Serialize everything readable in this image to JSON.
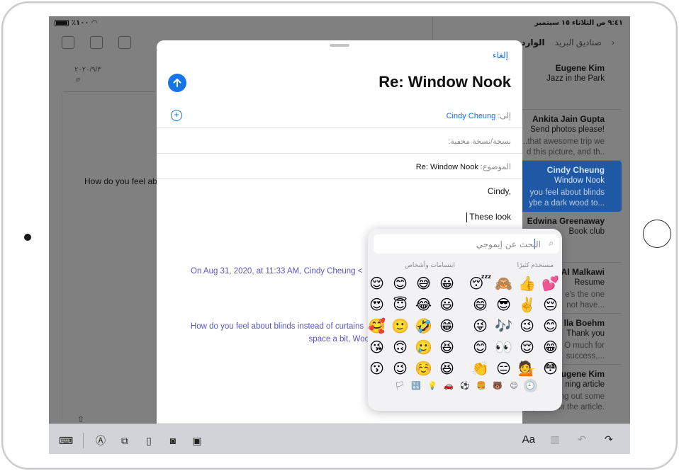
{
  "status": {
    "battery": "٪١٠٠",
    "time_date": "٩:٤١ ص  الثلاثاء ١٥ سبتمبر"
  },
  "message_view": {
    "date": "٢٠٢٠/٩/٣",
    "body_preview": "How do you feel ab"
  },
  "mailbox": {
    "back_label": "صناديق البريد",
    "inbox_label": "الوارد",
    "items": [
      {
        "name": "Eugene Kim",
        "subject": "Jazz in the Park",
        "preview": ""
      },
      {
        "name": "Ankita Jain Gupta",
        "subject": "Send photos please!",
        "preview": "...that awesome trip we\nd this picture, and th.."
      },
      {
        "name": "Cindy Cheung",
        "subject": "Window Nook",
        "preview": "you feel about blinds\nybe a dark wood to..."
      },
      {
        "name": "Edwina Greenaway",
        "subject": "Book club",
        "preview": ""
      },
      {
        "name": "Al Malkawi",
        "subject": "Resume",
        "preview": "e's the one\nnot have..."
      },
      {
        "name": "lla Boehm",
        "subject": "Thank you",
        "preview": "O much for\nsuccess,..."
      },
      {
        "name": "ugene Kim",
        "subject": "ning article",
        "preview": "cking out some\ne places in the article."
      }
    ]
  },
  "compose": {
    "cancel_label": "إلغاء",
    "title": "Re: Window Nook",
    "to_label": "إلى:",
    "to_value": "Cindy Cheung",
    "cc_label": "نسخة/نسخة مخفية:",
    "subject_label": "الموضوع:",
    "subject_value": "Re: Window Nook",
    "greeting": "Cindy,",
    "typed_text": "These look",
    "quote_header": "On Aug 31, 2020, at 11:33 AM, Cindy Cheung <",
    "quote_body_1": "How do you feel about blinds instead of curtains",
    "quote_body_2": "space a bit, Woo"
  },
  "emoji_keyboard": {
    "search_placeholder": "البحث عن إيموجي",
    "frequent_label": "مستخدَم كثيرًا",
    "smileys_label": "ابتسامات وأشخاص",
    "rows": [
      [
        "😌",
        "😊",
        "😅",
        "😀",
        "",
        "😴",
        "🙈",
        "👍",
        "💕"
      ],
      [
        "😍",
        "😇",
        "😂",
        "😃",
        "",
        "😄",
        "😎",
        "✌️",
        "😔"
      ],
      [
        "🥰",
        "🙂",
        "🤣",
        "😁",
        "",
        "😜",
        "🎶",
        "😉",
        "😊"
      ],
      [
        "😘",
        "🙃",
        "🥲",
        "😆",
        "",
        "😊",
        "👀",
        "😌",
        "😁"
      ],
      [
        "😗",
        "😉",
        "☺️",
        "😆",
        "",
        "👏",
        "😑",
        "💁",
        "😳"
      ]
    ],
    "tabs": [
      "🕘",
      "😊",
      "🐻",
      "🍔",
      "⚽",
      "🚗",
      "💡",
      "🔣",
      "🏳"
    ]
  },
  "bottom_toolbar": {
    "aa_label": "Aa"
  }
}
